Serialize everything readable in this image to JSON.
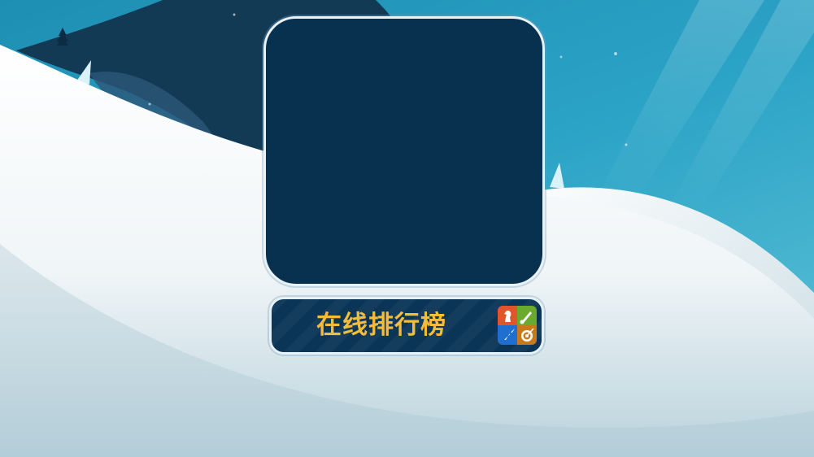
{
  "leaderboard_button": {
    "label": "在线排行榜",
    "icon": "game-center-icon"
  },
  "colors": {
    "sky": "#2ba3c6",
    "mountain": "#123a55",
    "snow": "#f6fafb",
    "panel": "#08304f",
    "button_text": "#f3bd3a"
  }
}
